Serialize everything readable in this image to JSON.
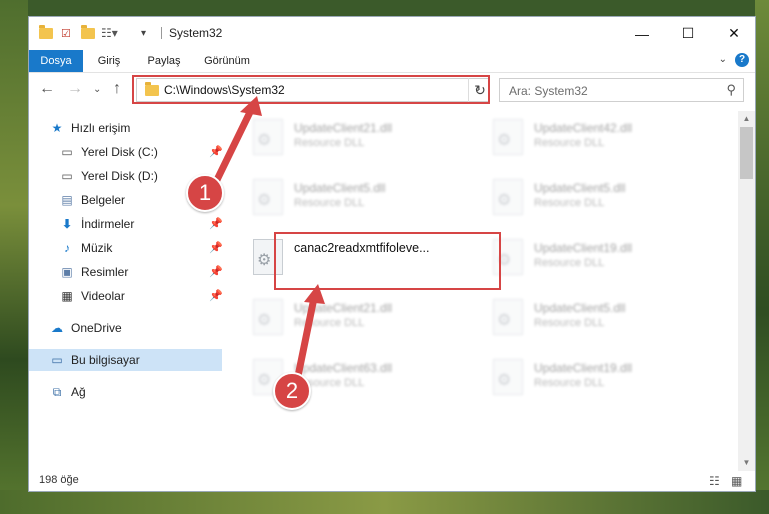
{
  "window": {
    "title": "System32",
    "controls": {
      "minimize": "—",
      "maximize": "☐",
      "close": "✕"
    }
  },
  "ribbon": {
    "tabs": [
      {
        "label": "Dosya",
        "active": true
      },
      {
        "label": "Giriş",
        "active": false
      },
      {
        "label": "Paylaş",
        "active": false
      },
      {
        "label": "Görünüm",
        "active": false
      }
    ],
    "help": "?"
  },
  "navbar": {
    "address": "C:\\Windows\\System32",
    "search_placeholder": "Ara: System32"
  },
  "sidebar": {
    "quick_access": "Hızlı erişim",
    "items": [
      {
        "label": "Yerel Disk (C:)",
        "icon": "drive-icon",
        "pinned": true
      },
      {
        "label": "Yerel Disk (D:)",
        "icon": "drive-icon",
        "pinned": false
      },
      {
        "label": "Belgeler",
        "icon": "documents-icon",
        "pinned": true
      },
      {
        "label": "İndirmeler",
        "icon": "downloads-icon",
        "pinned": true
      },
      {
        "label": "Müzik",
        "icon": "music-icon",
        "pinned": true
      },
      {
        "label": "Resimler",
        "icon": "pictures-icon",
        "pinned": true
      },
      {
        "label": "Videolar",
        "icon": "videos-icon",
        "pinned": true
      }
    ],
    "onedrive": "OneDrive",
    "this_pc": "Bu bilgisayar",
    "network": "Ağ"
  },
  "files": [
    {
      "name": "UpdateClient21.dll",
      "type": "Resource DLL"
    },
    {
      "name": "UpdateClient42.dll",
      "type": "Resource DLL"
    },
    {
      "name": "UpdateClient5.dll",
      "type": "Resource DLL"
    },
    {
      "name": "UpdateClient5.dll",
      "type": "Resource DLL"
    },
    {
      "name": "canac2readxmtfifoleve...",
      "type": ""
    },
    {
      "name": "UpdateClient19.dll",
      "type": "Resource DLL"
    },
    {
      "name": "UpdateClient21.dll",
      "type": "Resource DLL"
    },
    {
      "name": "UpdateClient5.dll",
      "type": "Resource DLL"
    },
    {
      "name": "UpdateClient63.dll",
      "type": "Resource DLL"
    },
    {
      "name": "UpdateClient19.dll",
      "type": "Resource DLL"
    }
  ],
  "status": {
    "count": "198 öğe"
  },
  "annotations": {
    "badge1": "1",
    "badge2": "2",
    "color": "#d64545"
  }
}
